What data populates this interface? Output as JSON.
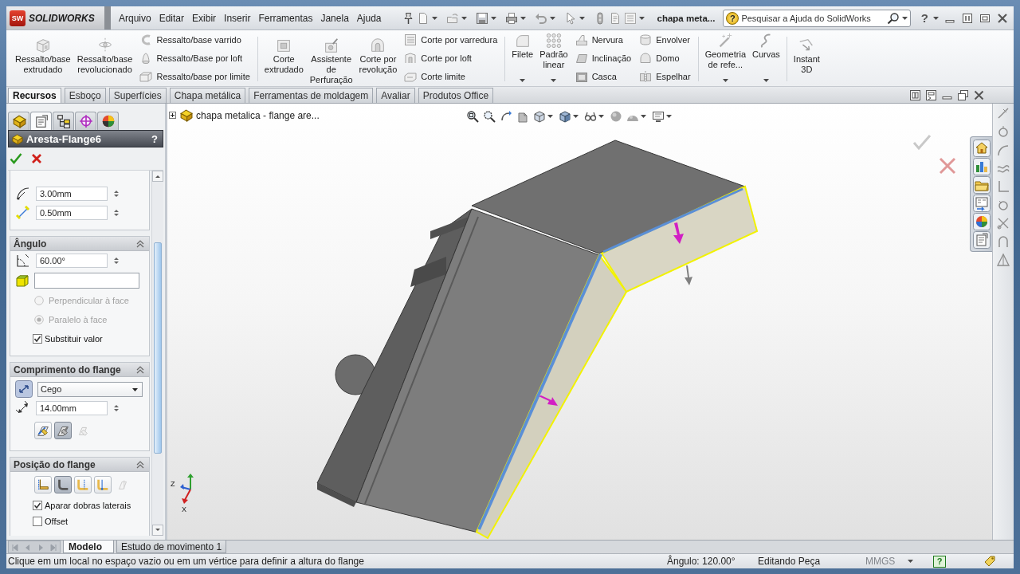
{
  "title_bar": {
    "logo_initials": "SW",
    "logo": "SOLIDWORKS",
    "menu": [
      "Arquivo",
      "Editar",
      "Exibir",
      "Inserir",
      "Ferramentas",
      "Janela",
      "Ajuda"
    ],
    "document": "chapa meta...",
    "search_help": "?",
    "search": {
      "placeholder": "Pesquisar a Ajuda do SolidWorks"
    },
    "help": "?"
  },
  "ribbon": [
    {
      "items": [
        {
          "kind": "large",
          "label": "Ressalto/base\nextrudado",
          "dropdown": false
        },
        {
          "kind": "large",
          "label": "Ressalto/base\nrevolucionado",
          "dropdown": false
        },
        {
          "kind": "small",
          "label": "Ressalto/base varrido"
        },
        {
          "kind": "small",
          "label": "Ressalto/Base por loft"
        },
        {
          "kind": "small",
          "label": "Ressalto/base por limite"
        }
      ]
    },
    {
      "items": [
        {
          "kind": "large",
          "label": "Corte\nextrudado",
          "dropdown": false
        },
        {
          "kind": "large",
          "label": "Assistente\nde\nPerfuração",
          "dropdown": false
        },
        {
          "kind": "large",
          "label": "Corte por\nrevolução",
          "dropdown": false
        },
        {
          "kind": "small",
          "label": "Corte por varredura"
        },
        {
          "kind": "small",
          "label": "Corte por loft"
        },
        {
          "kind": "small",
          "label": "Corte limite"
        }
      ]
    },
    {
      "items": [
        {
          "kind": "large",
          "label": "Filete",
          "dropdown": true
        },
        {
          "kind": "large",
          "label": "Padrão\nlinear",
          "dropdown": true
        },
        {
          "kind": "small",
          "label": "Nervura"
        },
        {
          "kind": "small",
          "label": "Inclinação"
        },
        {
          "kind": "small",
          "label": "Casca"
        },
        {
          "kind": "small",
          "label": "Envolver"
        },
        {
          "kind": "small",
          "label": "Domo"
        },
        {
          "kind": "small",
          "label": "Espelhar"
        }
      ]
    },
    {
      "items": [
        {
          "kind": "large",
          "label": "Geometria\nde refe...",
          "dropdown": true
        },
        {
          "kind": "large",
          "label": "Curvas",
          "dropdown": true
        }
      ]
    },
    {
      "items": [
        {
          "kind": "large",
          "label": "Instant\n3D",
          "dropdown": false
        }
      ]
    }
  ],
  "command_tabs": [
    {
      "label": "Recursos",
      "selected": true
    },
    {
      "label": "Esboço",
      "selected": false
    },
    {
      "label": "Superfícies",
      "selected": false
    },
    {
      "label": "Chapa metálica",
      "selected": false
    },
    {
      "label": "Ferramentas de moldagem",
      "selected": false
    },
    {
      "label": "Avaliar",
      "selected": false
    },
    {
      "label": "Produtos Office",
      "selected": false
    }
  ],
  "property_manager": {
    "tabs": [
      {
        "selected": false
      },
      {
        "selected": true
      },
      {
        "selected": false
      },
      {
        "selected": false
      },
      {
        "selected": false
      }
    ],
    "title": "Aresta-Flange6",
    "help": "?",
    "groups": [
      {
        "rows": [
          {
            "kind": "field",
            "value": "3.00mm"
          },
          {
            "kind": "field",
            "value": "0.50mm"
          }
        ]
      },
      {
        "title": "Ângulo",
        "expanded": true,
        "rows": [
          {
            "kind": "field",
            "value": "60.00°"
          },
          {
            "kind": "selection"
          },
          {
            "kind": "radio",
            "label": "Perpendicular à face",
            "selected": false,
            "disabled": true
          },
          {
            "kind": "radio",
            "label": "Paralelo à face",
            "selected": true,
            "disabled": true
          },
          {
            "kind": "checkbox",
            "label": "Substituir valor",
            "checked": true
          }
        ]
      },
      {
        "title": "Comprimento do flange",
        "expanded": true,
        "rows": [
          {
            "kind": "dropdown",
            "value": "Cego"
          },
          {
            "kind": "field",
            "value": "14.00mm"
          },
          {
            "kind": "buttons",
            "buttons": [
              {
                "selected": false,
                "disabled": false
              },
              {
                "selected": true,
                "disabled": false
              },
              {
                "selected": false,
                "disabled": true
              }
            ]
          }
        ]
      },
      {
        "title": "Posição do flange",
        "expanded": true,
        "rows": [
          {
            "kind": "buttons",
            "buttons": [
              {
                "selected": false,
                "disabled": false
              },
              {
                "selected": true,
                "disabled": false
              },
              {
                "selected": false,
                "disabled": false
              },
              {
                "selected": false,
                "disabled": false
              },
              {
                "selected": false,
                "disabled": true
              }
            ]
          },
          {
            "kind": "checkbox",
            "label": "Aparar dobras laterais",
            "checked": true
          },
          {
            "kind": "checkbox",
            "label": "Offset",
            "checked": false
          }
        ]
      }
    ]
  },
  "viewport": {
    "tree": {
      "label": "chapa metalica - flange are...",
      "expanded": false
    },
    "triad": [
      "Z",
      "X"
    ]
  },
  "bottom_tabs": [
    {
      "label": "Modelo",
      "selected": true
    },
    {
      "label": "Estudo de movimento 1",
      "selected": false
    }
  ],
  "status_bar": {
    "message": "Clique em um local no espaço vazio ou em um vértice para definir a altura do flange",
    "angle": "Ângulo: 120.00°",
    "mode": "Editando Peça",
    "units": "MMGS",
    "help": "?"
  }
}
